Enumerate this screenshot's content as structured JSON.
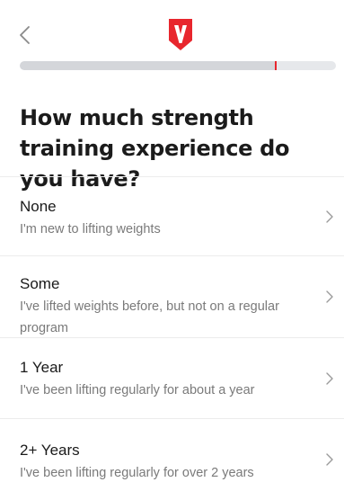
{
  "header": {
    "back_icon": "chevron-left-icon",
    "logo_icon": "v-shield-logo",
    "brand_color": "#e8262d"
  },
  "progress": {
    "value": 0.81
  },
  "question": {
    "title": "How much strength training experience do you have?"
  },
  "options": [
    {
      "title": "None",
      "description": "I'm new to lifting weights"
    },
    {
      "title": "Some",
      "description": "I've lifted weights before, but not on a regular program"
    },
    {
      "title": "1 Year",
      "description": "I've been lifting regularly for about a year"
    },
    {
      "title": "2+ Years",
      "description": "I've been lifting regularly for over 2 years"
    }
  ]
}
